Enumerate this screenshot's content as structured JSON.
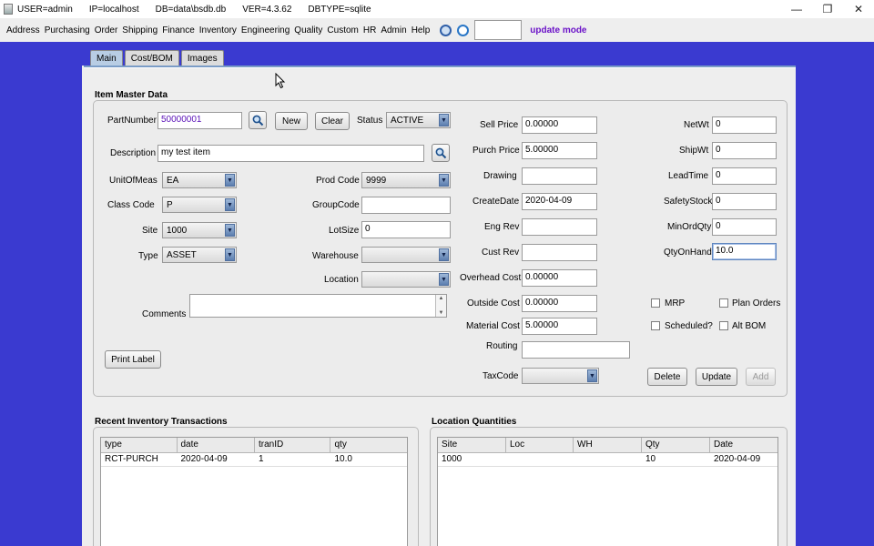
{
  "titlebar": {
    "user": "USER=admin",
    "ip": "IP=localhost",
    "db": "DB=data\\bsdb.db",
    "ver": "VER=4.3.62",
    "dbtype": "DBTYPE=sqlite",
    "controls": {
      "minimize": "—",
      "restore": "❐",
      "close": "✕"
    }
  },
  "menu": {
    "items": [
      "Address",
      "Purchasing",
      "Order",
      "Shipping",
      "Finance",
      "Inventory",
      "Engineering",
      "Quality",
      "Custom",
      "HR",
      "Admin",
      "Help"
    ],
    "mode_label": "update mode"
  },
  "tabs": [
    "Main",
    "Cost/BOM",
    "Images"
  ],
  "item_master": {
    "title": "Item Master Data",
    "part_number": {
      "label": "PartNumber",
      "value": "50000001"
    },
    "new_label": "New",
    "clear_label": "Clear",
    "status": {
      "label": "Status",
      "value": "ACTIVE"
    },
    "description": {
      "label": "Description",
      "value": "my test item"
    },
    "unit_of_meas": {
      "label": "UnitOfMeas",
      "value": "EA"
    },
    "class_code": {
      "label": "Class Code",
      "value": "P"
    },
    "site": {
      "label": "Site",
      "value": "1000"
    },
    "type": {
      "label": "Type",
      "value": "ASSET"
    },
    "prod_code": {
      "label": "Prod Code",
      "value": "9999"
    },
    "group_code": {
      "label": "GroupCode",
      "value": ""
    },
    "lot_size": {
      "label": "LotSize",
      "value": "0"
    },
    "warehouse": {
      "label": "Warehouse",
      "value": ""
    },
    "location": {
      "label": "Location",
      "value": ""
    },
    "comments": {
      "label": "Comments",
      "value": ""
    },
    "print_label": "Print Label",
    "sell_price": {
      "label": "Sell Price",
      "value": "0.00000"
    },
    "purch_price": {
      "label": "Purch Price",
      "value": "5.00000"
    },
    "drawing": {
      "label": "Drawing",
      "value": ""
    },
    "create_date": {
      "label": "CreateDate",
      "value": "2020-04-09"
    },
    "eng_rev": {
      "label": "Eng Rev",
      "value": ""
    },
    "cust_rev": {
      "label": "Cust Rev",
      "value": ""
    },
    "overhead_cost": {
      "label": "Overhead Cost",
      "value": "0.00000"
    },
    "outside_cost": {
      "label": "Outside Cost",
      "value": "0.00000"
    },
    "material_cost": {
      "label": "Material Cost",
      "value": "5.00000"
    },
    "routing": {
      "label": "Routing",
      "value": ""
    },
    "tax_code": {
      "label": "TaxCode",
      "value": ""
    },
    "net_wt": {
      "label": "NetWt",
      "value": "0"
    },
    "ship_wt": {
      "label": "ShipWt",
      "value": "0"
    },
    "lead_time": {
      "label": "LeadTime",
      "value": "0"
    },
    "safety_stock": {
      "label": "SafetyStock",
      "value": "0"
    },
    "min_ord_qty": {
      "label": "MinOrdQty",
      "value": "0"
    },
    "qty_on_hand": {
      "label": "QtyOnHand",
      "value": "10.0"
    },
    "checkboxes": {
      "mrp": "MRP",
      "plan_orders": "Plan Orders",
      "scheduled": "Scheduled?",
      "alt_bom": "Alt BOM"
    },
    "delete_label": "Delete",
    "update_label": "Update",
    "add_label": "Add"
  },
  "recent_transactions": {
    "title": "Recent Inventory Transactions",
    "columns": [
      "type",
      "date",
      "tranID",
      "qty"
    ],
    "rows": [
      [
        "RCT-PURCH",
        "2020-04-09",
        "1",
        "10.0"
      ]
    ]
  },
  "location_quantities": {
    "title": "Location Quantities",
    "columns": [
      "Site",
      "Loc",
      "WH",
      "Qty",
      "Date"
    ],
    "rows": [
      [
        "1000",
        "",
        "",
        "10",
        "2020-04-09"
      ]
    ]
  }
}
